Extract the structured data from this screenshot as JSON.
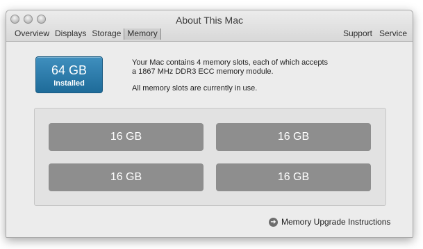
{
  "window": {
    "title": "About This Mac"
  },
  "tabs": [
    "Overview",
    "Displays",
    "Storage",
    "Memory"
  ],
  "right_tabs": [
    "Support",
    "Service"
  ],
  "badge": {
    "amount": "64 GB",
    "status": "Installed",
    "color": "#1e6b99"
  },
  "info": {
    "line1": "Your Mac contains 4 memory slots, each of which accepts",
    "line2": "a 1867 MHz DDR3 ECC memory module.",
    "line3": "All memory slots are currently in use."
  },
  "slots": [
    "16 GB",
    "16 GB",
    "16 GB",
    "16 GB"
  ],
  "upgrade_link": "Memory Upgrade Instructions",
  "icons": {
    "close": "close-icon",
    "minimize": "minimize-icon",
    "zoom": "zoom-icon",
    "link_arrow": "arrow-right-icon"
  }
}
